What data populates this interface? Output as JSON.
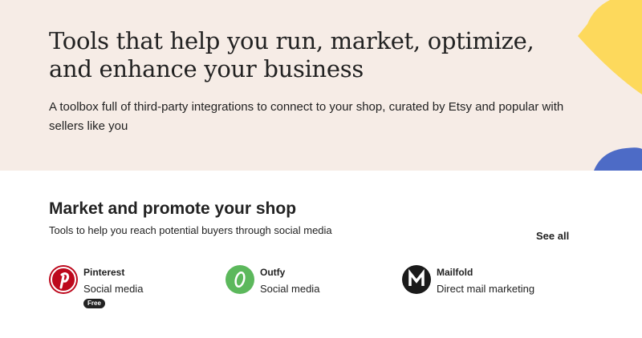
{
  "hero": {
    "title": "Tools that help you run, market, optimize, and enhance your business",
    "subtitle": "A toolbox full of third-party integrations to connect to your shop, curated by Etsy and popular with sellers like you"
  },
  "section": {
    "title": "Market and promote your shop",
    "description": "Tools to help you reach potential buyers through social media",
    "see_all_label": "See all"
  },
  "apps": [
    {
      "name": "Pinterest",
      "category": "Social media",
      "badge": "Free",
      "logo_icon": "pinterest-icon",
      "logo_color": "#bd081c",
      "logo_glyph": "P"
    },
    {
      "name": "Outfy",
      "category": "Social media",
      "logo_icon": "outfy-icon",
      "logo_color": "#5cb85c",
      "logo_glyph": "O"
    },
    {
      "name": "Mailfold",
      "category": "Direct mail marketing",
      "logo_icon": "mailfold-icon",
      "logo_color": "#1a1a1a",
      "logo_glyph": "M"
    }
  ],
  "colors": {
    "hero_background": "#f6ece6",
    "accent_yellow": "#fdd95c",
    "accent_blue": "#4d6bc6"
  }
}
